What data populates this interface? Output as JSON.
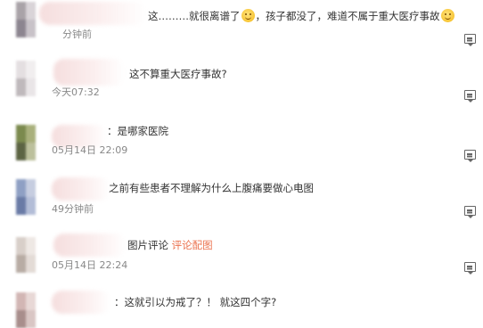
{
  "comments": [
    {
      "text_before": "这………就很离谱了",
      "text_mid": "，孩子都没了，难道不属于重大医疗事故",
      "emoji": "smiley-emoji",
      "time": "分钟前"
    },
    {
      "text": "这不算重大医疗事故?",
      "time": "今天07:32"
    },
    {
      "text": "：是哪家医院",
      "time": "05月14日 22:09"
    },
    {
      "text": "之前有些患者不理解为什么上腹痛要做心电图",
      "time": "49分钟前"
    },
    {
      "text": "图片评论",
      "link": "评论配图",
      "time": "05月14日 22:24"
    },
    {
      "text": "：这就引以为戒了？！ 就这四个字?"
    }
  ],
  "colors": {
    "link": "#eb7350",
    "time": "#888888",
    "text": "#333333"
  },
  "icons": {
    "reply": "comment-reply-icon"
  }
}
